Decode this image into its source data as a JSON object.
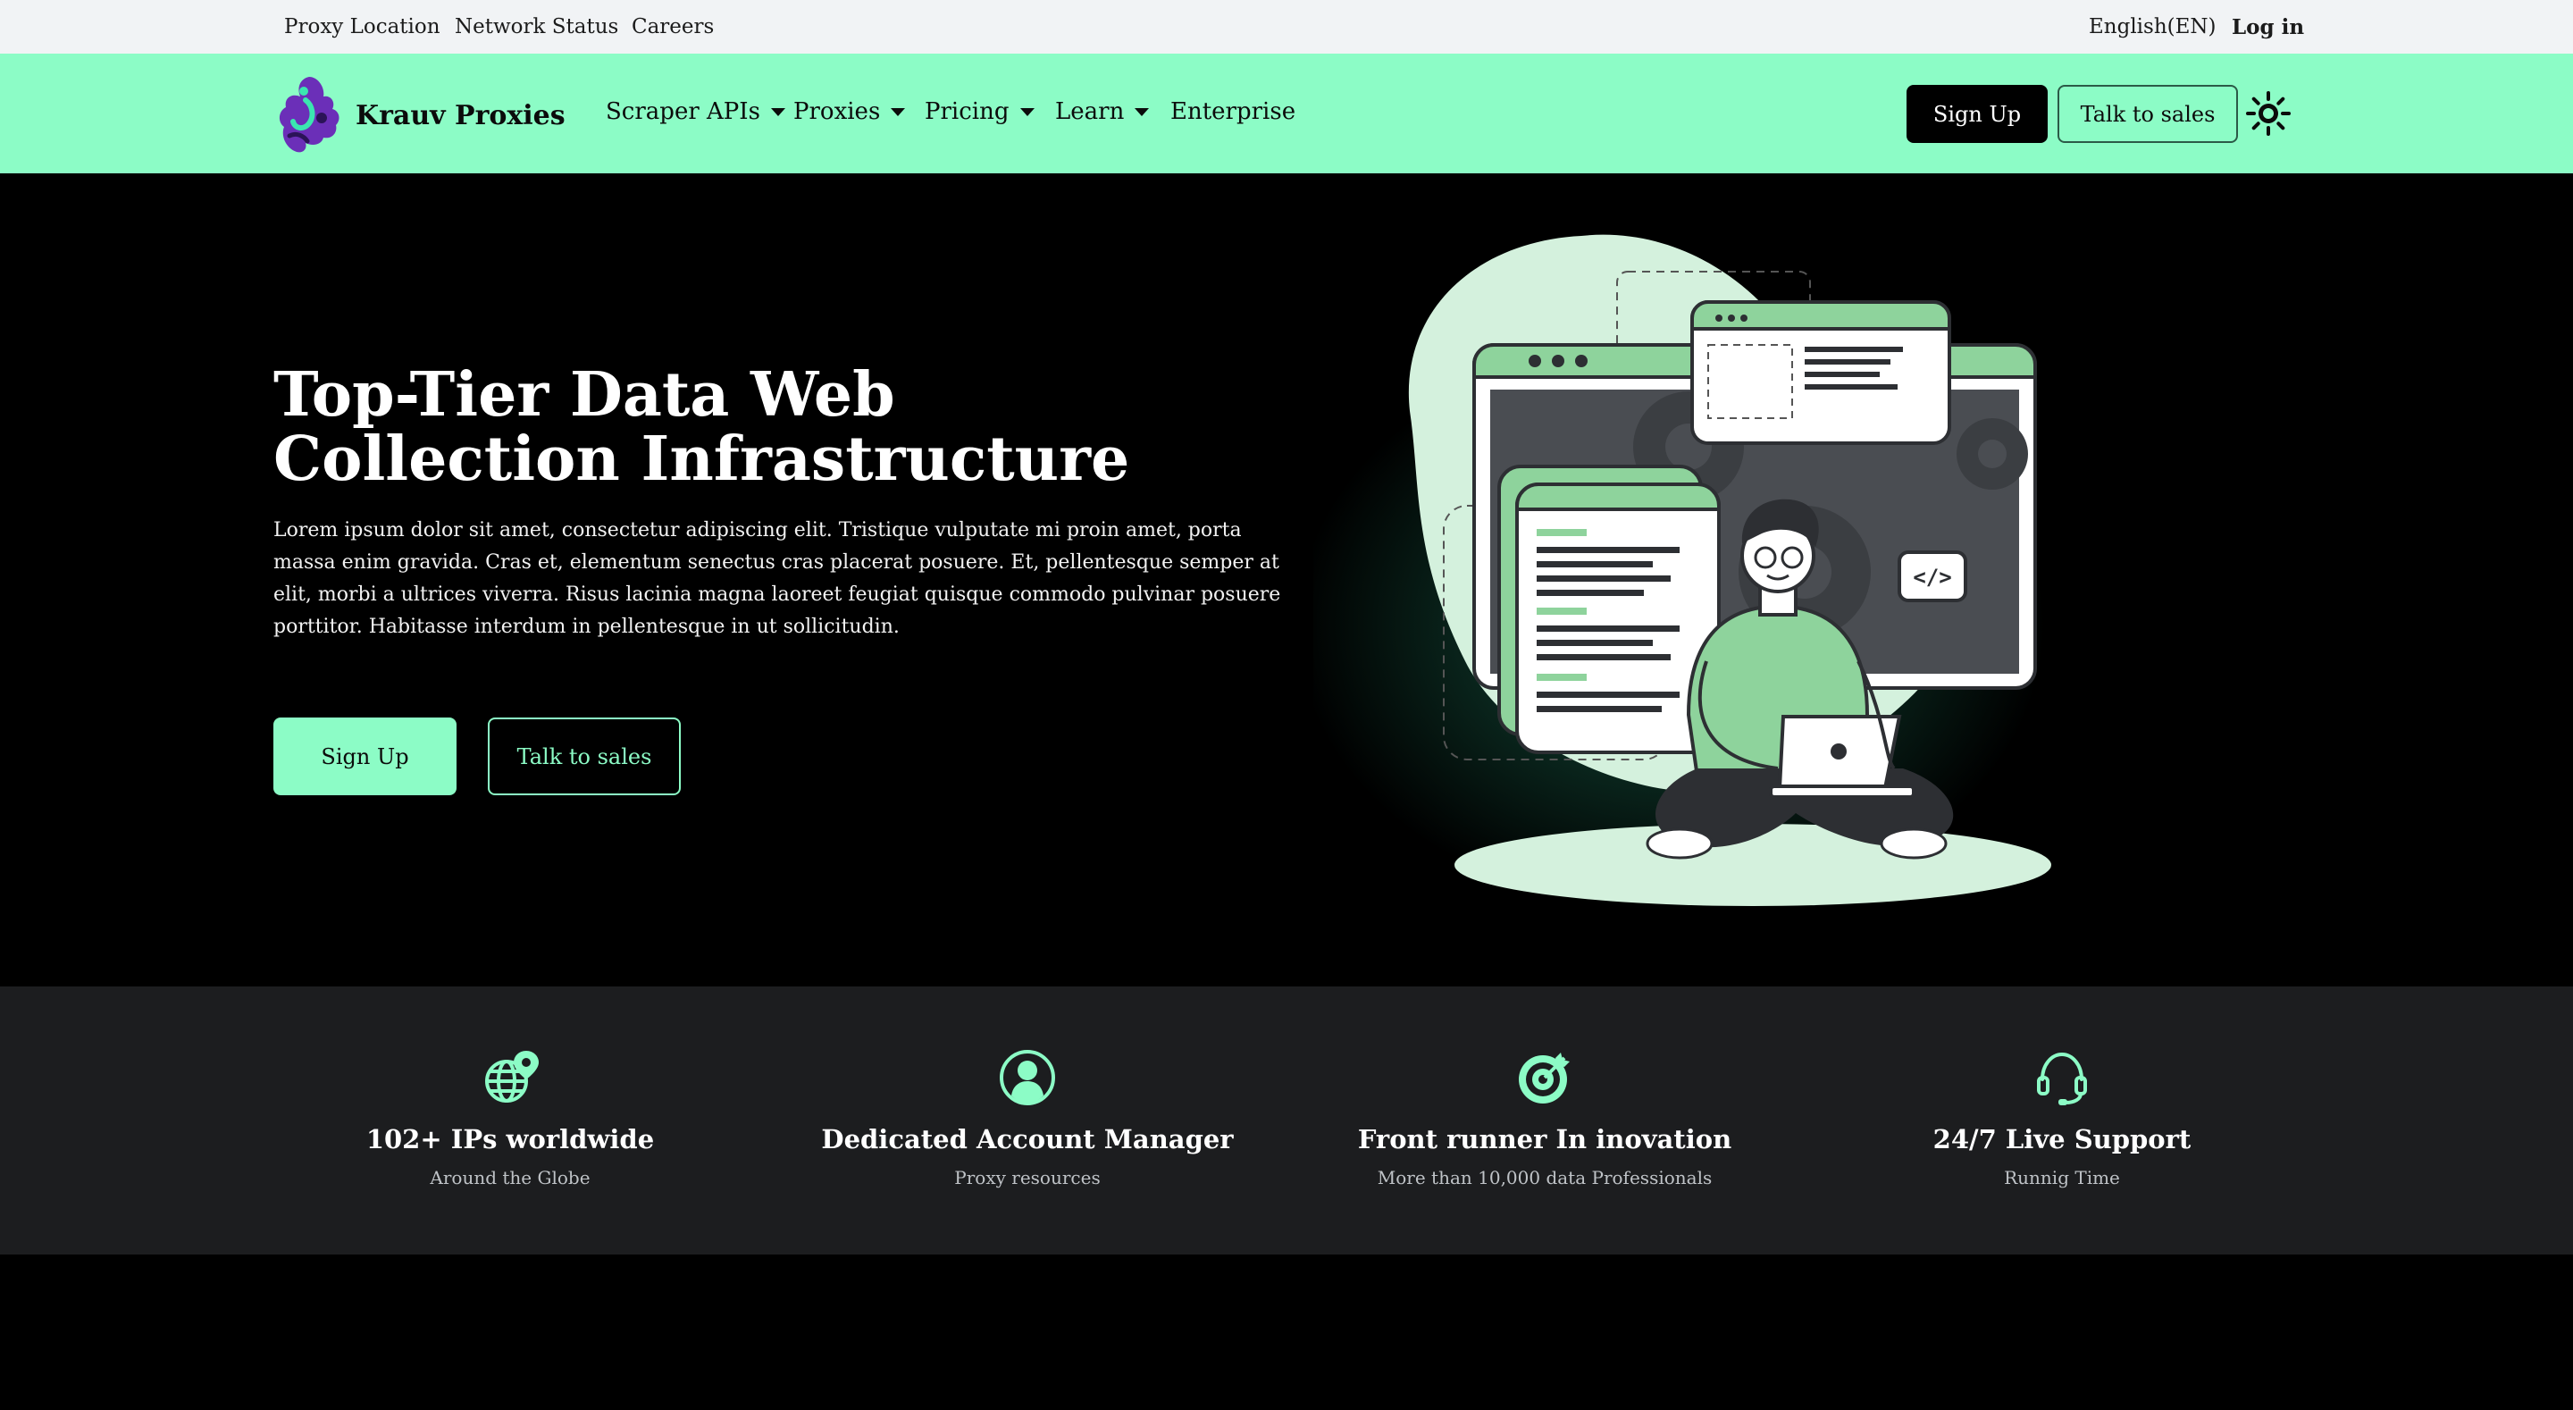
{
  "topbar": {
    "links": [
      "Proxy Location",
      "Network Status",
      "Careers"
    ],
    "language": "English(EN)",
    "login": "Log in"
  },
  "nav": {
    "brand": "Krauv Proxies",
    "items": [
      "Scraper APIs",
      "Proxies",
      "Pricing",
      "Learn",
      "Enterprise"
    ],
    "signup": "Sign Up",
    "talk_to_sales": "Talk to sales",
    "theme_icon": "sun-icon"
  },
  "hero": {
    "title": "Top-Tier Data Web Collection Infrastructure",
    "body": "Lorem ipsum dolor sit amet, consectetur adipiscing elit. Tristique vulputate mi proin amet, porta massa enim gravida. Cras et, elementum senectus cras placerat posuere. Et, pellentesque semper at elit, morbi a ultrices viverra. Risus lacinia magna laoreet feugiat quisque commodo pulvinar posuere porttitor. Habitasse interdum in pellentesque in ut sollicitudin.",
    "signup": "Sign Up",
    "talk_to_sales": "Talk to sales",
    "illustration_code_tag": "</>"
  },
  "features": [
    {
      "icon": "globe-location-icon",
      "title": "102+ IPs worldwide",
      "subtitle": "Around the Globe"
    },
    {
      "icon": "user-icon",
      "title": "Dedicated Account Manager",
      "subtitle": "Proxy resources"
    },
    {
      "icon": "target-icon",
      "title": "Front runner In inovation",
      "subtitle": "More than 10,000 data Professionals"
    },
    {
      "icon": "headset-icon",
      "title": "24/7 Live Support",
      "subtitle": "Runnig Time"
    }
  ],
  "colors": {
    "accent": "#8cfcc6",
    "topbar_bg": "#f1f3f5",
    "hero_bg": "#000000",
    "features_bg": "#1c1d1f"
  }
}
